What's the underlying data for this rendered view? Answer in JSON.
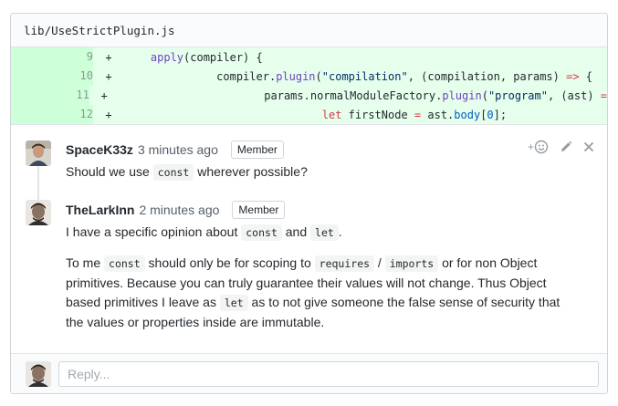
{
  "file": {
    "path": "lib/UseStrictPlugin.js"
  },
  "diff": {
    "lines": [
      {
        "num": "9",
        "marker": "+"
      },
      {
        "num": "10",
        "marker": "+"
      },
      {
        "num": "11",
        "marker": "+"
      },
      {
        "num": "12",
        "marker": "+"
      }
    ],
    "code": {
      "l9_fn": "apply",
      "l9_rest": "(compiler) {",
      "l10_a": "compiler.",
      "l10_fn": "plugin",
      "l10_b": "(",
      "l10_str": "\"compilation\"",
      "l10_c": ", (compilation, params) ",
      "l10_arrow": "=>",
      "l10_d": " {",
      "l11_a": "params.normalModuleFactory.",
      "l11_fn": "plugin",
      "l11_b": "(",
      "l11_str": "\"program\"",
      "l11_c": ", (ast) ",
      "l11_arrow": "=",
      "l12_kw": "let",
      "l12_a": " firstNode ",
      "l12_eq": "=",
      "l12_b": " ast.",
      "l12_prop": "body",
      "l12_c": "[",
      "l12_num": "0",
      "l12_d": "];"
    }
  },
  "comments": [
    {
      "author": "SpaceK33z",
      "time": "3 minutes ago",
      "badge": "Member",
      "body": {
        "t1": "Should we use ",
        "c1": "const",
        "t2": " wherever possible?"
      }
    },
    {
      "author": "TheLarkInn",
      "time": "2 minutes ago",
      "badge": "Member",
      "body": {
        "p1_t1": "I have a specific opinion about ",
        "p1_c1": "const",
        "p1_t2": " and ",
        "p1_c2": "let",
        "p1_t3": ".",
        "p2_t1": "To me ",
        "p2_c1": "const",
        "p2_t2": " should only be for scoping to ",
        "p2_c2": "requires",
        "p2_t3": " / ",
        "p2_c3": "imports",
        "p2_t4": " or for non Object primitives. Because you can truly guarantee their values will not change. Thus Object based primitives I leave as ",
        "p2_c4": "let",
        "p2_t5": " as to not give someone the false sense of security that the values or properties inside are immutable."
      }
    }
  ],
  "actions": {
    "reaction_plus": "+"
  },
  "reply": {
    "placeholder": "Reply..."
  },
  "colors": {
    "diff_added_bg": "#e6ffed",
    "diff_linenum_bg": "#cdffd8",
    "border": "#d1d5da"
  }
}
